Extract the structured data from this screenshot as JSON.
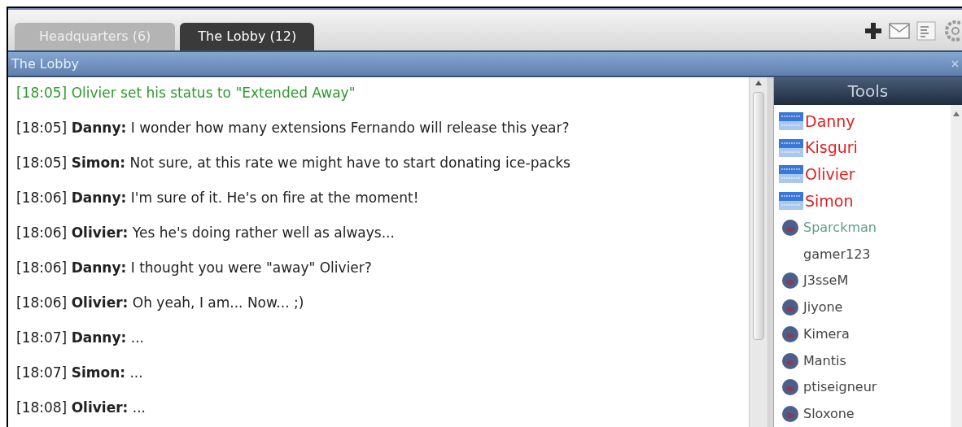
{
  "tabs": [
    {
      "label": "Headquarters (6)",
      "selected": false
    },
    {
      "label": "The Lobby (12)",
      "selected": true
    }
  ],
  "room": {
    "title": "The Lobby"
  },
  "messages": [
    {
      "kind": "status",
      "time": "[18:05]",
      "text": "Olivier set his status to \"Extended Away\""
    },
    {
      "kind": "chat",
      "time": "[18:05]",
      "author": "Danny:",
      "text": "I wonder how many extensions Fernando will release this year?"
    },
    {
      "kind": "chat",
      "time": "[18:05]",
      "author": "Simon:",
      "text": "Not sure, at this rate we might have to start donating ice-packs"
    },
    {
      "kind": "chat",
      "time": "[18:06]",
      "author": "Danny:",
      "text": "I'm sure of it. He's on fire at the moment!"
    },
    {
      "kind": "chat",
      "time": "[18:06]",
      "author": "Olivier:",
      "text": "Yes he's doing rather well as always..."
    },
    {
      "kind": "chat",
      "time": "[18:06]",
      "author": "Danny:",
      "text": "I thought you were \"away\" Olivier?"
    },
    {
      "kind": "chat",
      "time": "[18:06]",
      "author": "Olivier:",
      "text": "Oh yeah, I am... Now... ;)"
    },
    {
      "kind": "chat",
      "time": "[18:07]",
      "author": "Danny:",
      "text": "..."
    },
    {
      "kind": "chat",
      "time": "[18:07]",
      "author": "Simon:",
      "text": "..."
    },
    {
      "kind": "chat",
      "time": "[18:08]",
      "author": "Olivier:",
      "text": "..."
    }
  ],
  "tools": {
    "title": "Tools",
    "users": [
      {
        "kind": "staff",
        "name": "Danny",
        "color": "#e02020"
      },
      {
        "kind": "staff",
        "name": "Kisguri",
        "color": "#e02020"
      },
      {
        "kind": "staff",
        "name": "Olivier",
        "color": "#e02020"
      },
      {
        "kind": "staff",
        "name": "Simon",
        "color": "#e02020"
      },
      {
        "kind": "member",
        "name": "Sparckman",
        "color": "#5f9e8c"
      },
      {
        "kind": "none",
        "name": "gamer123",
        "color": "#444444"
      },
      {
        "kind": "member",
        "name": "J3sseM",
        "color": "#444444"
      },
      {
        "kind": "member",
        "name": "Jiyone",
        "color": "#444444"
      },
      {
        "kind": "member",
        "name": "Kimera",
        "color": "#444444"
      },
      {
        "kind": "member",
        "name": "Mantis",
        "color": "#444444"
      },
      {
        "kind": "member",
        "name": "ptiseigneur",
        "color": "#444444"
      },
      {
        "kind": "member",
        "name": "Sloxone",
        "color": "#444444"
      }
    ]
  }
}
